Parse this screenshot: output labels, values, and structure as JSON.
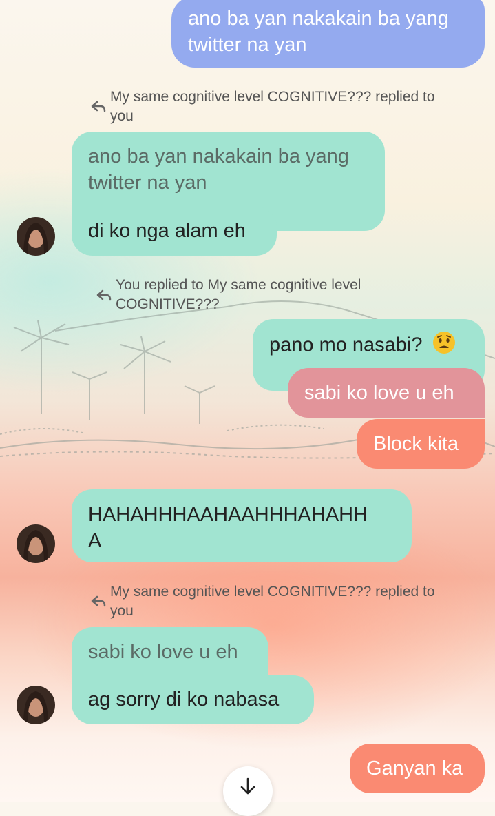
{
  "messages": {
    "m1": {
      "text_line1": "ano ba yan nakakain ba yang",
      "text_line2": "twitter na yan"
    },
    "reply1": {
      "line1": "My same cognitive level COGNITIVE??? replied to",
      "line2": "you"
    },
    "m2": {
      "quoted_line1": "ano ba yan nakakain ba yang",
      "quoted_line2": "twitter na yan",
      "text": "di ko nga alam eh"
    },
    "reply2": {
      "line1": "You replied to My same cognitive level",
      "line2": "COGNITIVE???"
    },
    "m3": {
      "text": "pano mo nasabi?",
      "emoji": "worried-face"
    },
    "m4": {
      "quoted": "sabi ko love u eh"
    },
    "m5": {
      "text": "Block kita"
    },
    "m6": {
      "line1": "HAHAHHHAAHAAHHHAHAHH",
      "line2": "A"
    },
    "reply3": {
      "line1": "My same cognitive level COGNITIVE??? replied to",
      "line2": "you"
    },
    "m7": {
      "quoted": "sabi ko love u eh",
      "text": "ag sorry di ko nabasa"
    },
    "m8": {
      "text": "Ganyan ka"
    }
  },
  "colors": {
    "sent_blue": "#94aaef",
    "received_teal": "#a1e4d1",
    "quoted_pink": "#e2949a",
    "sent_coral": "#fa8a72"
  },
  "icons": {
    "scroll_down": "arrow-down-icon",
    "reply": "reply-arrow-icon"
  }
}
